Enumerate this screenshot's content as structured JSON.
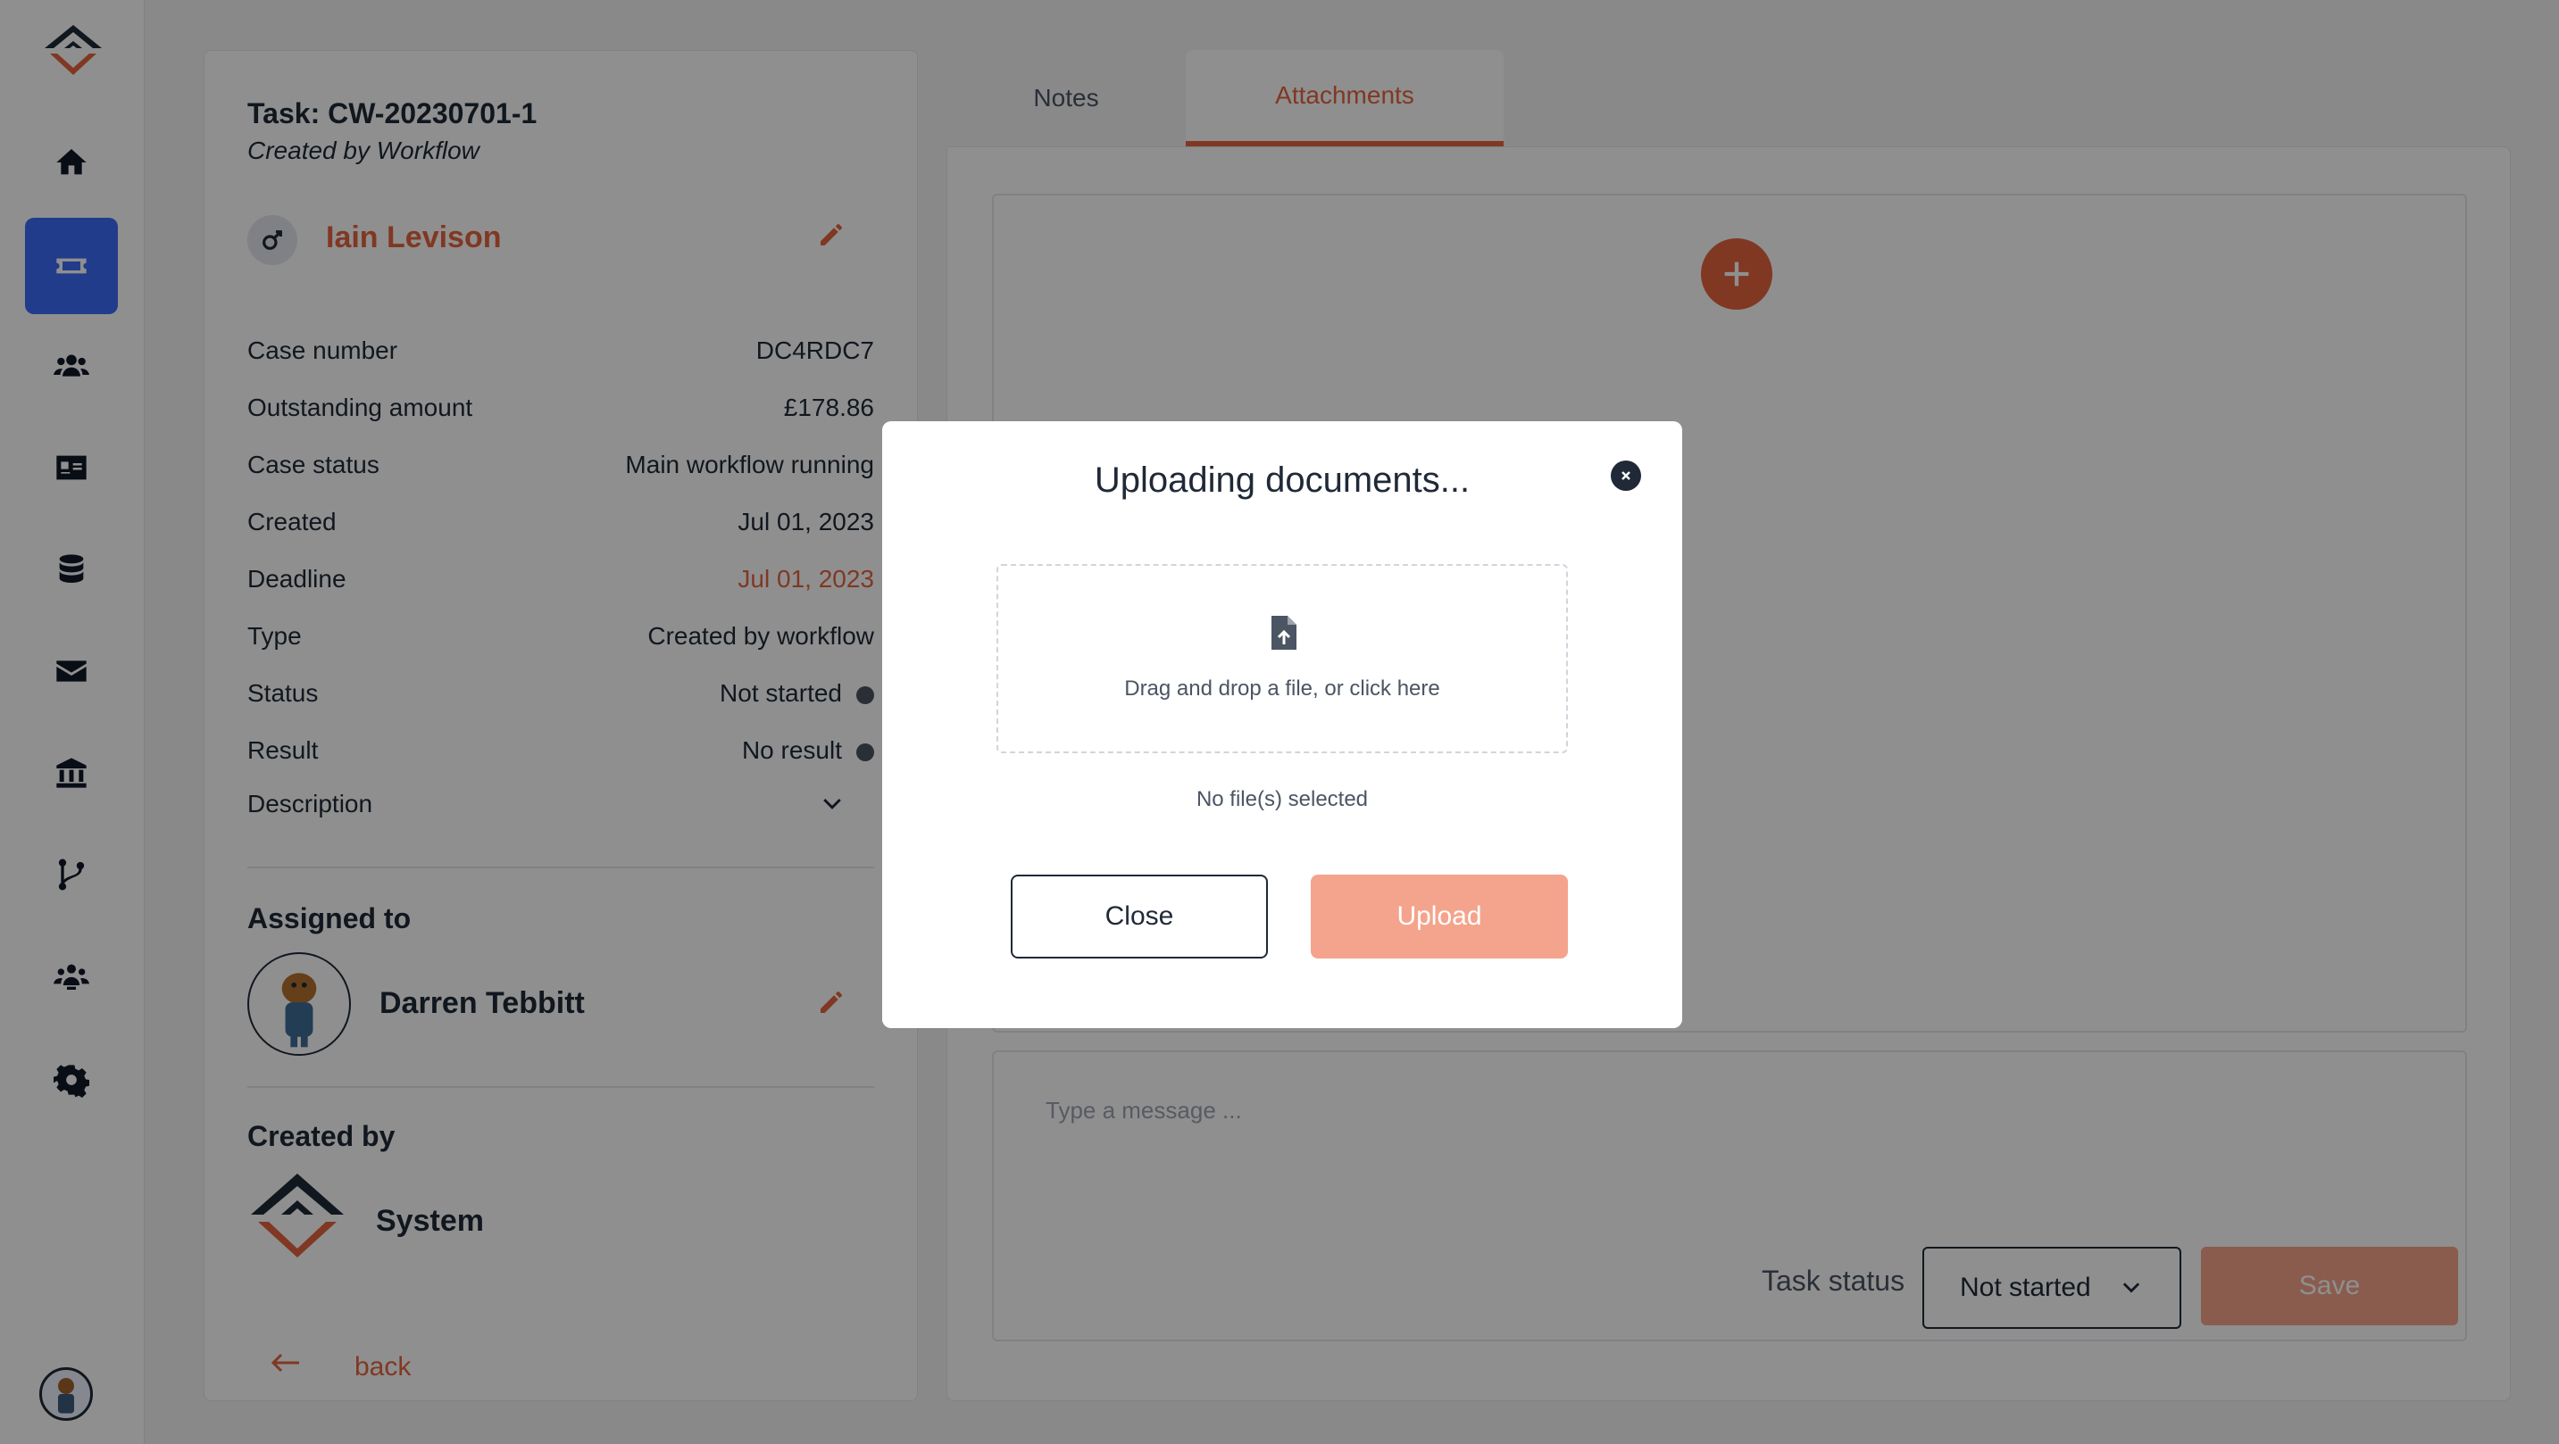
{
  "sidebar": {
    "items": [
      {
        "icon": "home-icon"
      },
      {
        "icon": "ticket-icon",
        "active": true
      },
      {
        "icon": "users-icon"
      },
      {
        "icon": "contact-card-icon"
      },
      {
        "icon": "database-icon"
      },
      {
        "icon": "envelope-icon"
      },
      {
        "icon": "bank-icon"
      },
      {
        "icon": "branch-icon"
      },
      {
        "icon": "team-icon"
      },
      {
        "icon": "gear-icon"
      }
    ]
  },
  "task": {
    "title": "Task: CW-20230701-1",
    "subtitle": "Created by Workflow",
    "person": "Iain Levison",
    "fields": [
      {
        "label": "Case number",
        "value": "DC4RDC7"
      },
      {
        "label": "Outstanding amount",
        "value": "£178.86"
      },
      {
        "label": "Case status",
        "value": "Main workflow running"
      },
      {
        "label": "Created",
        "value": "Jul 01, 2023"
      },
      {
        "label": "Deadline",
        "value": "Jul 01, 2023"
      },
      {
        "label": "Type",
        "value": "Created by workflow"
      },
      {
        "label": "Status",
        "value": "Not started"
      },
      {
        "label": "Result",
        "value": "No result"
      },
      {
        "label": "Description",
        "value": ""
      }
    ],
    "assigned_heading": "Assigned to",
    "assignee": "Darren Tebbitt",
    "created_heading": "Created by",
    "creator": "System",
    "back_label": "back"
  },
  "tabs": {
    "notes": "Notes",
    "attachments": "Attachments"
  },
  "composer": {
    "placeholder": "Type a message ...",
    "status_label": "Task status",
    "status_value": "Not started",
    "save_label": "Save"
  },
  "modal": {
    "title": "Uploading documents...",
    "drop_text": "Drag and drop a file, or click here",
    "no_file": "No file(s) selected",
    "close_label": "Close",
    "upload_label": "Upload"
  },
  "colors": {
    "accent": "#e4643f",
    "active_nav": "#3b6cf6",
    "disabled_accent": "#f4a48c"
  }
}
